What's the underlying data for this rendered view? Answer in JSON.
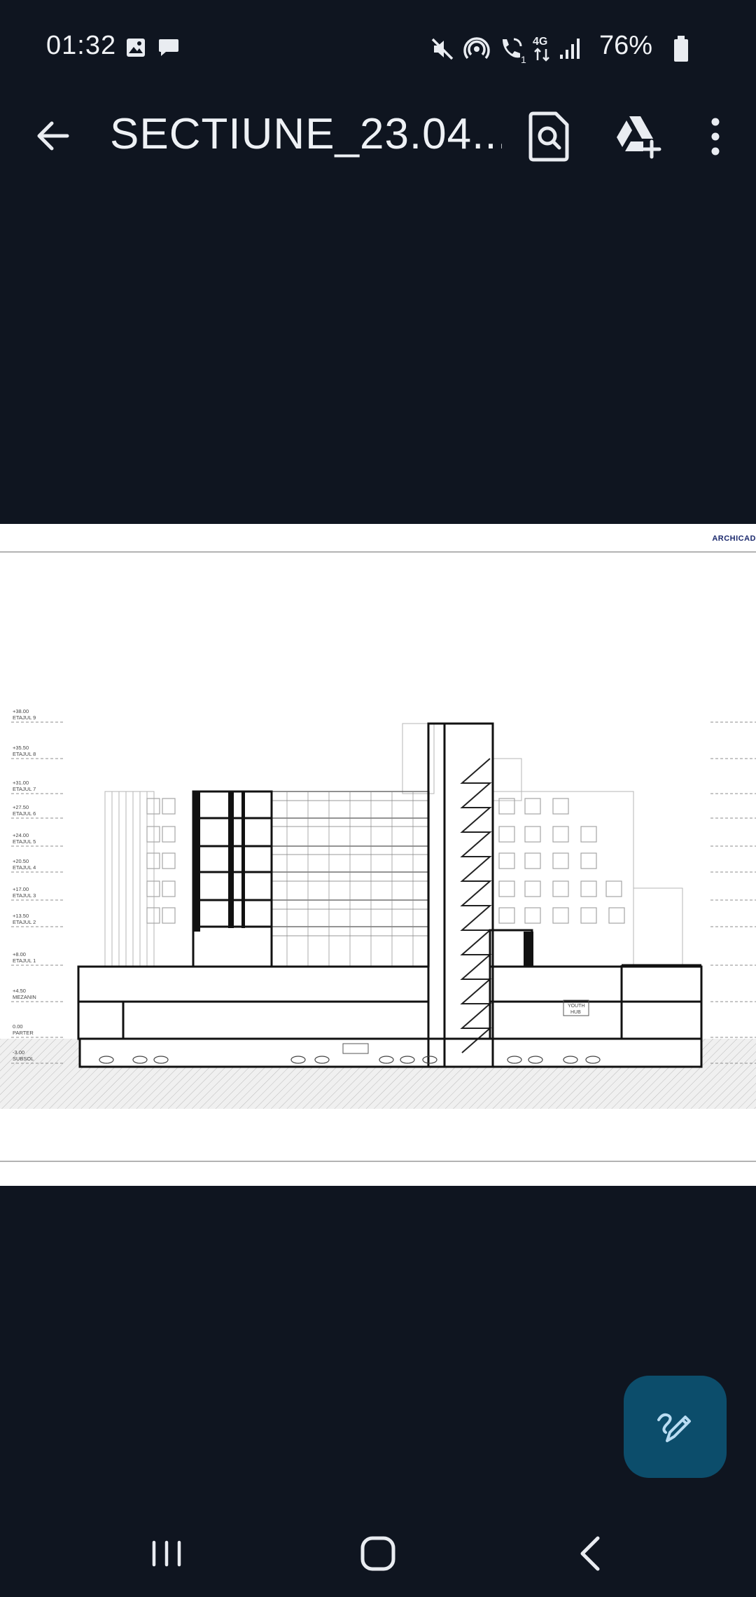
{
  "status": {
    "time": "01:32",
    "battery": "76%",
    "network": "4G",
    "call_sim": "1"
  },
  "app_bar": {
    "title": "SECTIUNE_23.04...."
  },
  "document": {
    "brand": "ARCHICAD",
    "levels_left": [
      {
        "elev": "+38.00",
        "name": "ETAJUL 9"
      },
      {
        "elev": "+35.50",
        "name": "ETAJUL 8"
      },
      {
        "elev": "+31.00",
        "name": "ETAJUL 7"
      },
      {
        "elev": "+27.50",
        "name": "ETAJUL 6"
      },
      {
        "elev": "+24.00",
        "name": "ETAJUL 5"
      },
      {
        "elev": "+20.50",
        "name": "ETAJUL 4"
      },
      {
        "elev": "+17.00",
        "name": "ETAJUL 3"
      },
      {
        "elev": "+13.50",
        "name": "ETAJUL 2"
      },
      {
        "elev": "+8.00",
        "name": "ETAJUL 1"
      },
      {
        "elev": "+4.50",
        "name": "MEZANIN"
      },
      {
        "elev": "0.00",
        "name": "PARTER"
      },
      {
        "elev": "-3.00",
        "name": "SUBSOL"
      }
    ],
    "youth_hub": [
      "YOUTH",
      "HUB"
    ]
  },
  "icons": {
    "back": "arrow-left-icon",
    "search": "document-search-icon",
    "drive": "drive-add-icon",
    "menu": "more-vertical-icon",
    "fab": "edit-pen-icon",
    "nav_recent": "recent-apps-icon",
    "nav_home": "home-icon",
    "nav_back": "nav-back-icon"
  },
  "colors": {
    "background": "#0f1520",
    "fab": "#0c4d6b",
    "fab_icon": "#b9dcf2",
    "brand": "#1c2a6e"
  }
}
